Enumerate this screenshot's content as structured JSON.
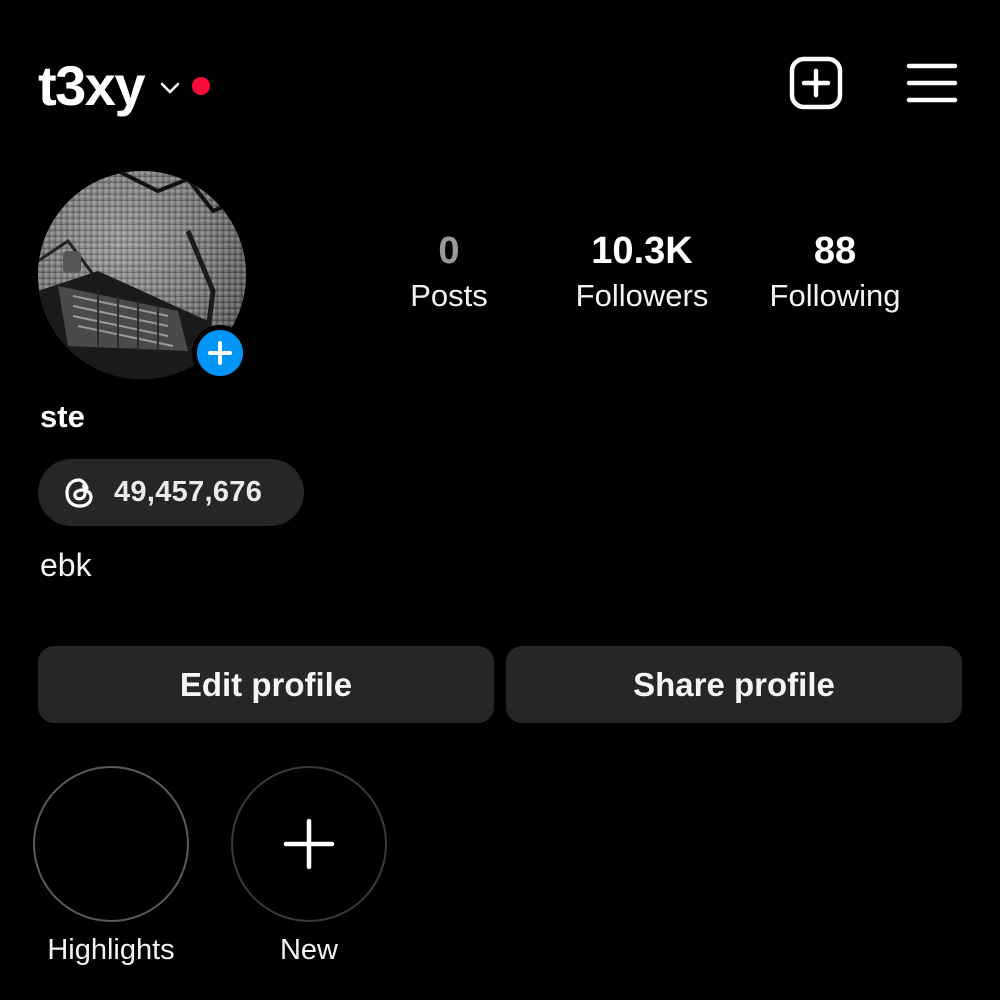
{
  "header": {
    "username": "t3xy",
    "has_notification_dot": true,
    "accent_dot_color": "#ff0a3c"
  },
  "profile": {
    "display_name": "ste",
    "bio": "ebk",
    "threads_count": "49,457,676",
    "add_story_color": "#0095f6"
  },
  "stats": {
    "posts": {
      "value": "0",
      "label": "Posts"
    },
    "followers": {
      "value": "10.3K",
      "label": "Followers"
    },
    "following": {
      "value": "88",
      "label": "Following"
    }
  },
  "actions": {
    "edit_label": "Edit profile",
    "share_label": "Share profile"
  },
  "highlights": [
    {
      "label": "Highlights",
      "icon": "empty"
    },
    {
      "label": "New",
      "icon": "plus-icon"
    }
  ],
  "icons": [
    "chevron-down-icon",
    "create-post-icon",
    "hamburger-menu-icon",
    "plus-icon",
    "threads-icon"
  ]
}
